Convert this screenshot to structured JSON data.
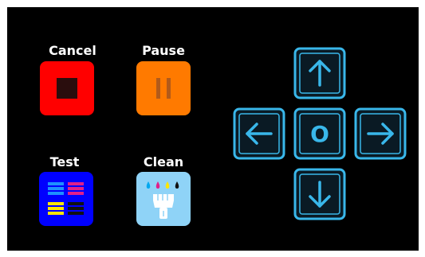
{
  "screen": {
    "background": "#000000"
  },
  "controls": {
    "cancel": {
      "label": "Cancel",
      "color": "#ff0000",
      "icon": "stop-icon"
    },
    "pause": {
      "label": "Pause",
      "color": "#ff7a00",
      "icon": "pause-icon"
    },
    "test": {
      "label": "Test",
      "color": "#0000ff",
      "icon": "test-pattern-icon"
    },
    "clean": {
      "label": "Clean",
      "color": "#8fd3f7",
      "icon": "clean-brush-icon"
    }
  },
  "dpad": {
    "accent": "#39b7ea",
    "up_icon": "arrow-up-icon",
    "down_icon": "arrow-down-icon",
    "left_icon": "arrow-left-icon",
    "right_icon": "arrow-right-icon",
    "center_label": "O"
  }
}
